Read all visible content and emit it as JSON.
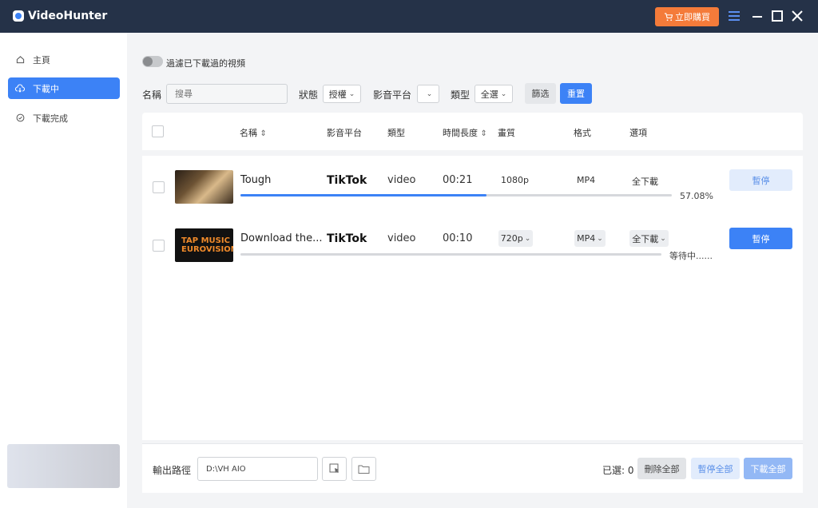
{
  "app": {
    "title": "VideoHunter",
    "buy_label": "立即購買"
  },
  "sidebar": {
    "items": [
      {
        "label": "主頁",
        "icon": "home-icon"
      },
      {
        "label": "下載中",
        "icon": "download-cloud-icon",
        "active": true
      },
      {
        "label": "下載完成",
        "icon": "check-circle-icon"
      }
    ]
  },
  "filters": {
    "toggle_label": "過濾已下載過的視頻",
    "name_label": "名稱",
    "search_placeholder": "搜尋",
    "status_label": "狀態",
    "status_value": "授權",
    "platform_label": "影音平台",
    "platform_value": "",
    "type_label": "類型",
    "type_value": "全選",
    "filter_button": "篩选",
    "reset_button": "重置"
  },
  "table": {
    "headers": {
      "name": "名稱",
      "platform": "影音平台",
      "type": "類型",
      "duration": "時間長度",
      "quality": "畫質",
      "format": "格式",
      "options": "選項"
    }
  },
  "rows": [
    {
      "title": "Tough",
      "platform": "TikTok",
      "type": "video",
      "duration": "00:21",
      "quality": "1080p",
      "format": "MP4",
      "option": "全下載",
      "status": "57.08%",
      "progress": 0.5708,
      "action": "暫停"
    },
    {
      "title": "Download the...",
      "platform": "TikTok",
      "type": "video",
      "duration": "00:10",
      "quality": "720p",
      "format": "MP4",
      "option": "全下載",
      "status": "等待中......",
      "progress": 0,
      "action": "暫停",
      "thumb_text": "TAP MUSIC EUROVISION"
    }
  ],
  "footer": {
    "output_label": "輸出路徑",
    "output_path": "D:\\VH AIO",
    "selected_label": "已選: 0",
    "delete_all": "刪除全部",
    "pause_all": "暫停全部",
    "download_all": "下載全部"
  },
  "colors": {
    "accent": "#3c82f6",
    "titlebar": "#253248",
    "buy": "#f47b3a"
  }
}
